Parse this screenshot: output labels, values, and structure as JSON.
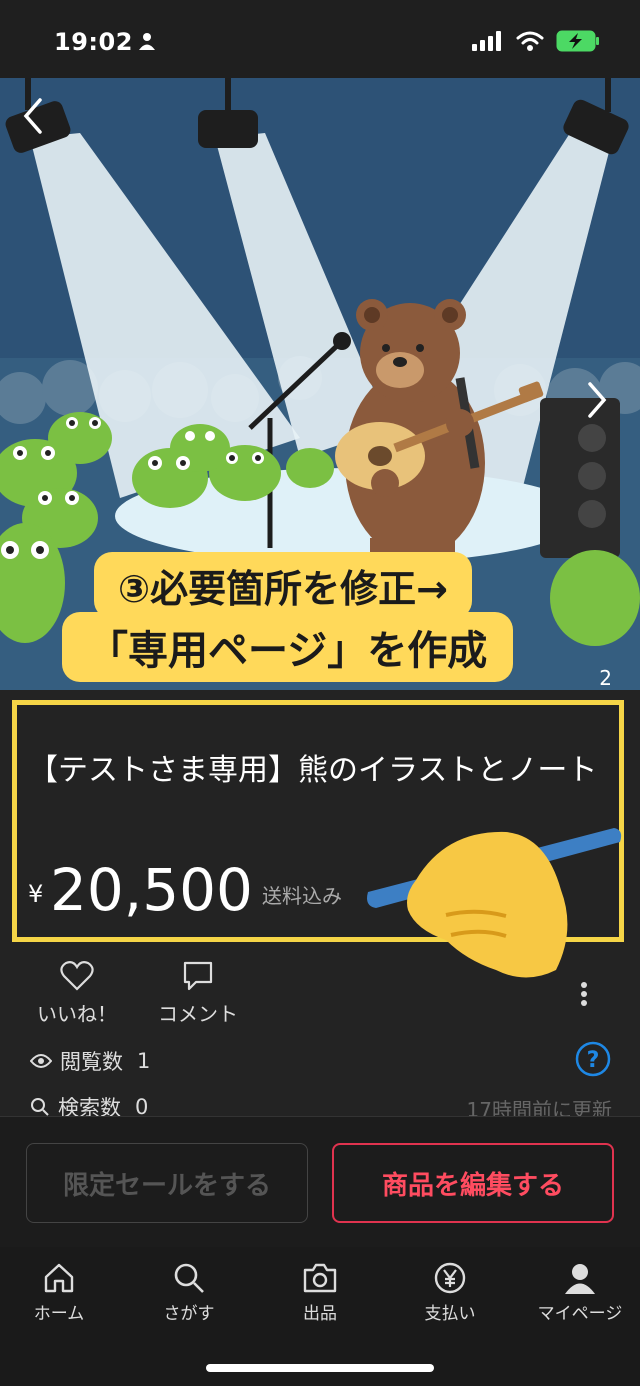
{
  "status": {
    "time": "19:02"
  },
  "product": {
    "title": "【テストさま専用】熊のイラストとノート",
    "currency": "¥",
    "price": "20,500",
    "shipping": "送料込み",
    "image_page": "2"
  },
  "callout": {
    "line1": "③必要箇所を修正→",
    "line2": "「専用ページ」を作成"
  },
  "actions": {
    "like": "いいね！",
    "comment": "コメント"
  },
  "stats": {
    "views_label": "閲覧数",
    "views": "1",
    "search_label": "検索数",
    "search": "0",
    "updated": "17時間前に更新"
  },
  "buttons": {
    "sale": "限定セールをする",
    "edit": "商品を編集する"
  },
  "tabs": [
    {
      "label": "ホーム",
      "icon": "home-icon"
    },
    {
      "label": "さがす",
      "icon": "search-icon"
    },
    {
      "label": "出品",
      "icon": "camera-icon"
    },
    {
      "label": "支払い",
      "icon": "yen-icon"
    },
    {
      "label": "マイページ",
      "icon": "person-icon"
    }
  ],
  "colors": {
    "accent": "#e0334f",
    "highlight": "#f5d547",
    "help": "#1e88e5"
  }
}
